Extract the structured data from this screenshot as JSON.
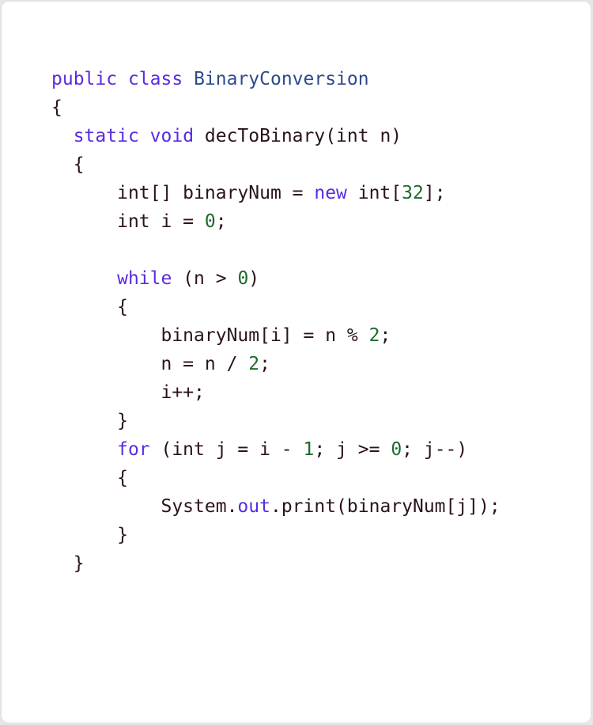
{
  "code_lines": [
    {
      "indent": "",
      "tokens": [
        {
          "t": "public",
          "k": "kw"
        },
        {
          "t": " ",
          "k": ""
        },
        {
          "t": "class",
          "k": "kw"
        },
        {
          "t": " ",
          "k": ""
        },
        {
          "t": "BinaryConversion",
          "k": "cls"
        }
      ]
    },
    {
      "indent": "",
      "tokens": [
        {
          "t": "{",
          "k": ""
        }
      ]
    },
    {
      "indent": "  ",
      "tokens": [
        {
          "t": "static",
          "k": "kw"
        },
        {
          "t": " ",
          "k": ""
        },
        {
          "t": "void",
          "k": "kw"
        },
        {
          "t": " decToBinary(int n)",
          "k": ""
        }
      ]
    },
    {
      "indent": "  ",
      "tokens": [
        {
          "t": "{",
          "k": ""
        }
      ]
    },
    {
      "indent": "      ",
      "tokens": [
        {
          "t": "int[] binaryNum = ",
          "k": ""
        },
        {
          "t": "new",
          "k": "kw"
        },
        {
          "t": " int[",
          "k": ""
        },
        {
          "t": "32",
          "k": "num"
        },
        {
          "t": "];",
          "k": ""
        }
      ]
    },
    {
      "indent": "      ",
      "tokens": [
        {
          "t": "int i = ",
          "k": ""
        },
        {
          "t": "0",
          "k": "num"
        },
        {
          "t": ";",
          "k": ""
        }
      ]
    },
    {
      "indent": "",
      "tokens": []
    },
    {
      "indent": "      ",
      "tokens": [
        {
          "t": "while",
          "k": "kw"
        },
        {
          "t": " (n > ",
          "k": ""
        },
        {
          "t": "0",
          "k": "num"
        },
        {
          "t": ")",
          "k": ""
        }
      ]
    },
    {
      "indent": "      ",
      "tokens": [
        {
          "t": "{",
          "k": ""
        }
      ]
    },
    {
      "indent": "          ",
      "tokens": [
        {
          "t": "binaryNum[i] = n % ",
          "k": ""
        },
        {
          "t": "2",
          "k": "num"
        },
        {
          "t": ";",
          "k": ""
        }
      ]
    },
    {
      "indent": "          ",
      "tokens": [
        {
          "t": "n = n / ",
          "k": ""
        },
        {
          "t": "2",
          "k": "num"
        },
        {
          "t": ";",
          "k": ""
        }
      ]
    },
    {
      "indent": "          ",
      "tokens": [
        {
          "t": "i++;",
          "k": ""
        }
      ]
    },
    {
      "indent": "      ",
      "tokens": [
        {
          "t": "}",
          "k": ""
        }
      ]
    },
    {
      "indent": "      ",
      "tokens": [
        {
          "t": "for",
          "k": "kw"
        },
        {
          "t": " (int j = i - ",
          "k": ""
        },
        {
          "t": "1",
          "k": "num"
        },
        {
          "t": "; j >= ",
          "k": ""
        },
        {
          "t": "0",
          "k": "num"
        },
        {
          "t": "; j--)",
          "k": ""
        }
      ]
    },
    {
      "indent": "      ",
      "tokens": [
        {
          "t": "{",
          "k": ""
        }
      ]
    },
    {
      "indent": "          ",
      "tokens": [
        {
          "t": "System.",
          "k": ""
        },
        {
          "t": "out",
          "k": "kw"
        },
        {
          "t": ".print(binaryNum[j]);",
          "k": ""
        }
      ]
    },
    {
      "indent": "      ",
      "tokens": [
        {
          "t": "}",
          "k": ""
        }
      ]
    },
    {
      "indent": "  ",
      "tokens": [
        {
          "t": "}",
          "k": ""
        }
      ]
    }
  ]
}
